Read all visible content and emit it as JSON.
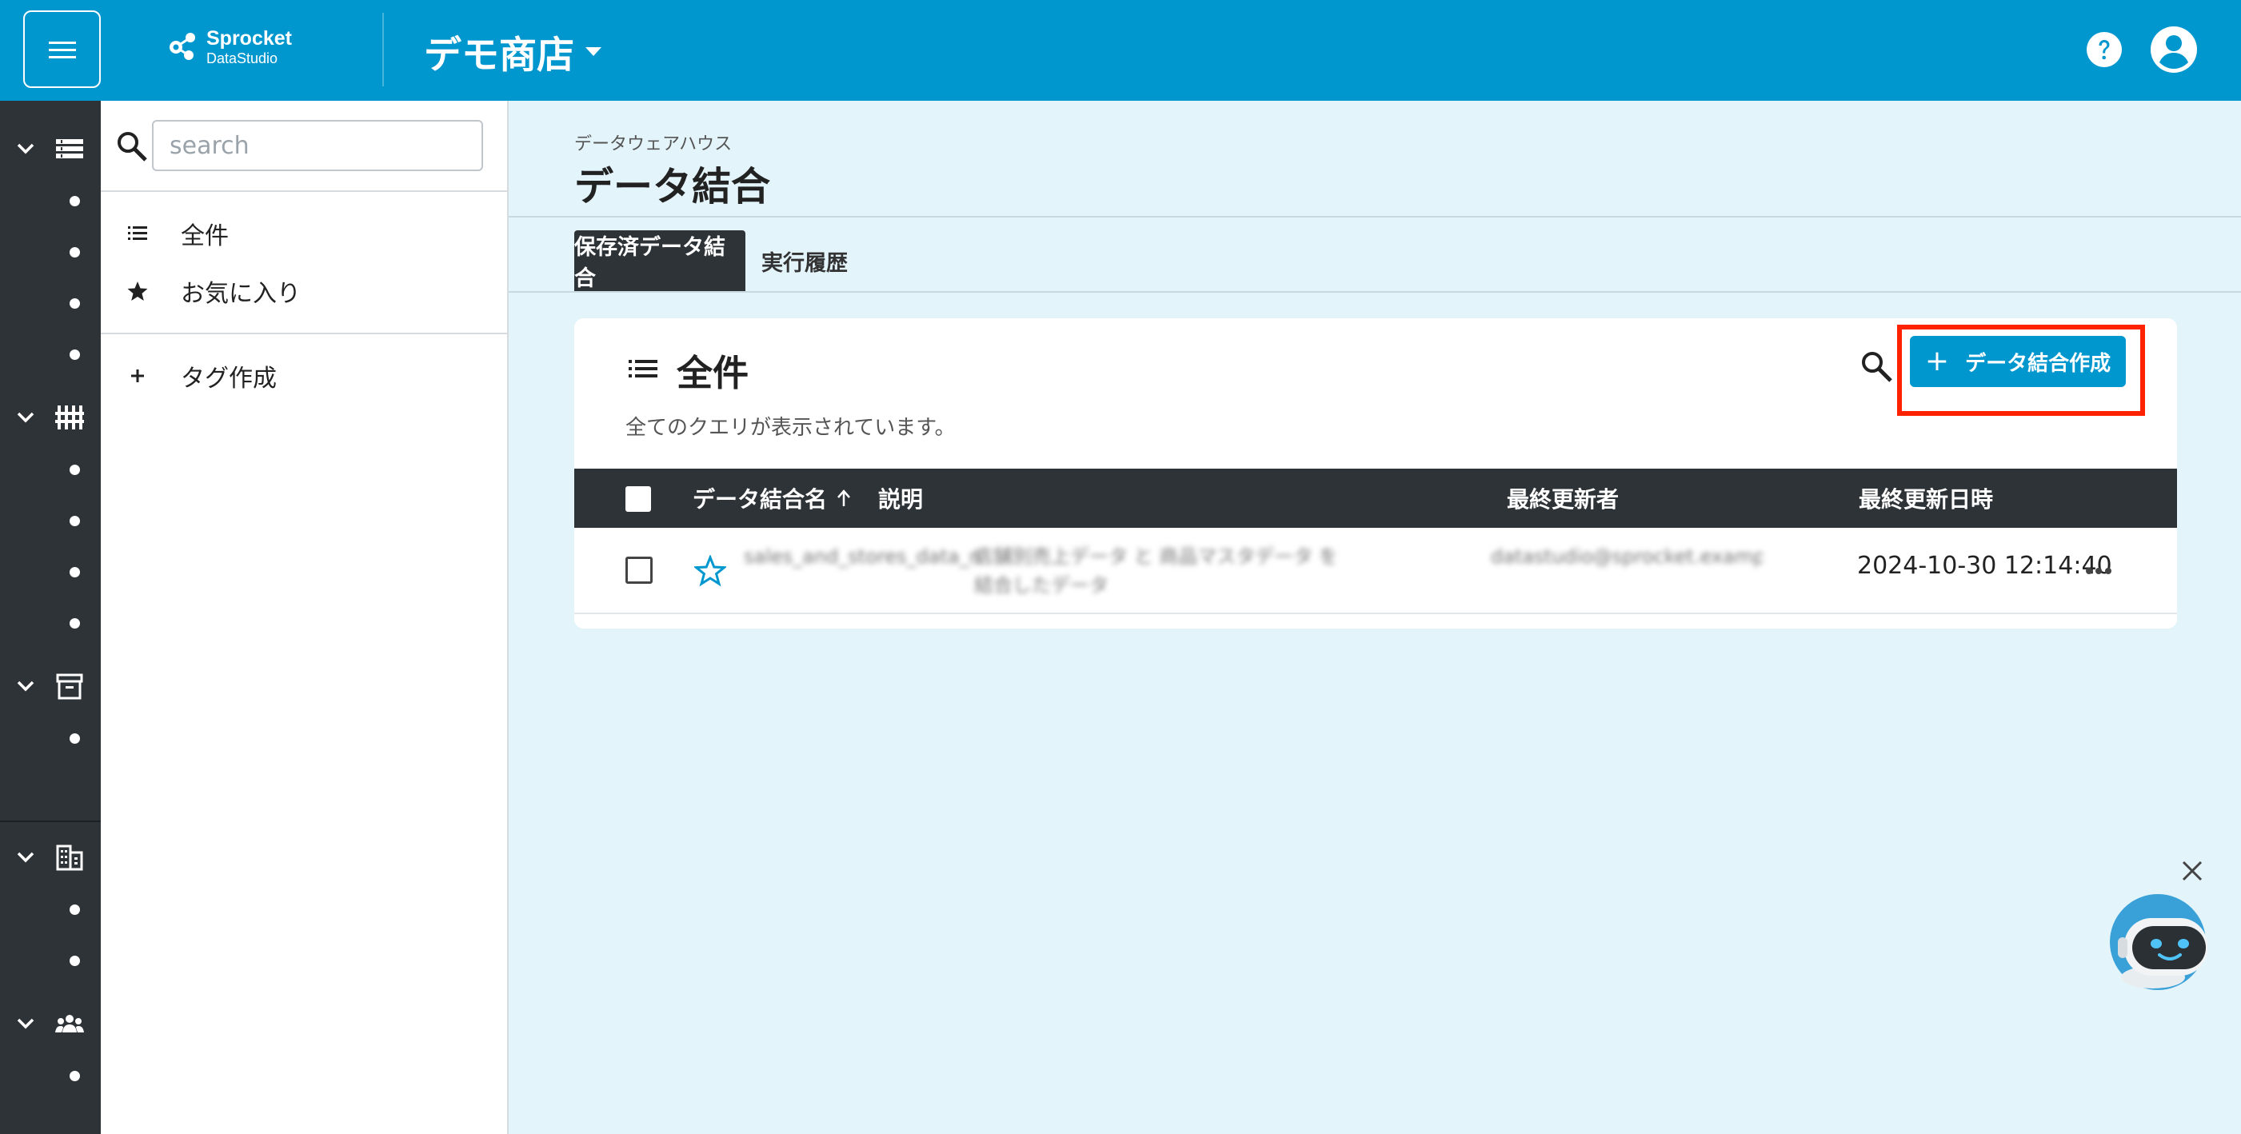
{
  "header": {
    "brand_name": "Sprocket",
    "brand_sub": "DataStudio",
    "store_name": "デモ商店"
  },
  "colors": {
    "header_bg": "#0097cf",
    "rail_bg": "#2e3337",
    "main_bg": "#e3f4fb",
    "highlight": "#ff2200",
    "accent": "#0097cf"
  },
  "sidebar": {
    "search_placeholder": "search",
    "items": [
      {
        "label": "全件",
        "icon": "list-icon"
      },
      {
        "label": "お気に入り",
        "icon": "star-filled-icon"
      }
    ],
    "create_tag_label": "タグ作成"
  },
  "main": {
    "breadcrumb": "データウェアハウス",
    "title": "データ結合",
    "tabs": [
      {
        "label": "保存済データ結合",
        "active": true
      },
      {
        "label": "実行履歴",
        "active": false
      }
    ],
    "card": {
      "title": "全件",
      "description": "全てのクエリが表示されています。",
      "create_button_label": "データ結合作成",
      "columns": [
        "データ結合名",
        "説明",
        "最終更新者",
        "最終更新日時"
      ],
      "rows": [
        {
          "name": "sales_and_stores_data_merge",
          "description": "店舗別売上データ と 商品マスタデータ を結合したデータ",
          "updated_by": "datastudio@sprocket.example.com",
          "updated_at": "2024-10-30 12:14:40"
        }
      ]
    }
  }
}
